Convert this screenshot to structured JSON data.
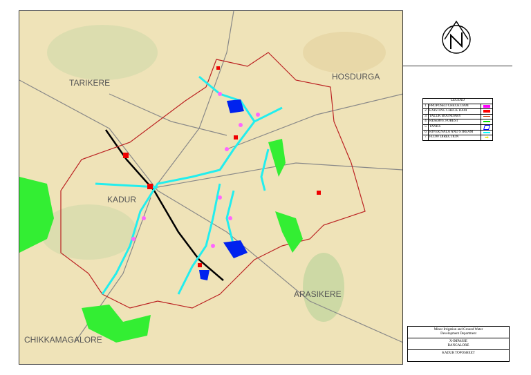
{
  "map": {
    "places": {
      "tarikere": "TARIKERE",
      "hosdurga": "HOSDURGA",
      "kadur": "KADUR",
      "arasikere": "ARASIKERE",
      "chikkamagalore": "CHIKKAMAGALORE"
    }
  },
  "legend": {
    "title": "LEGEND",
    "items": [
      {
        "num": "1",
        "label": "PROPOSED CHECK DAM",
        "color": "#ff00ff"
      },
      {
        "num": "2",
        "label": "EXISTING CHECK DAM",
        "color": "#ff0000"
      },
      {
        "num": "3",
        "label": "TALUK BOUNDARY",
        "color": "#cc3300"
      },
      {
        "num": "4",
        "label": "RESERVE FOREST",
        "color": "#00dd00"
      },
      {
        "num": "5",
        "label": "TANKS",
        "color": "#0000ff"
      },
      {
        "num": "6",
        "label": "RIVER,NALA AND STREAM",
        "color": "#00ffff"
      },
      {
        "num": "7",
        "label": "FLOW DIRECTION",
        "color": "#ffff00"
      }
    ]
  },
  "titleblock": {
    "org_line1": "Minor Irrigation and Ground Water",
    "org_line2": "Development Department",
    "office_line1": "X-IMPASSE",
    "office_line2": "BANGALORE",
    "sheet": "KADUR TOPOSHEET"
  }
}
